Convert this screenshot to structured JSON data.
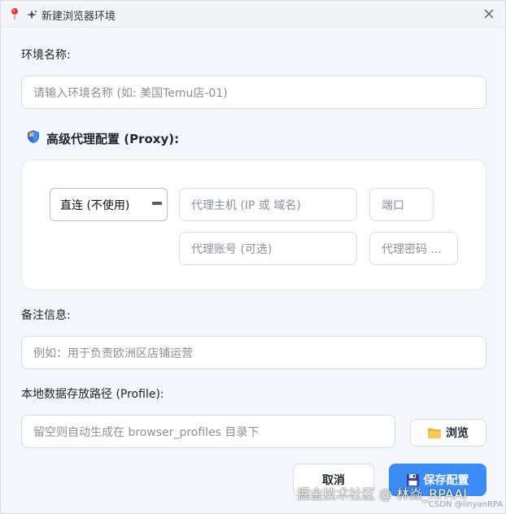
{
  "window": {
    "title": "新建浏览器环境"
  },
  "env_name": {
    "label": "环境名称:",
    "placeholder": "请输入环境名称 (如: 美国Temu店-01)"
  },
  "proxy": {
    "section_title": "高级代理配置 (Proxy):",
    "mode_selected": "直连 (不使用)",
    "host_placeholder": "代理主机 (IP 或 域名)",
    "port_placeholder": "端口",
    "user_placeholder": "代理账号 (可选)",
    "pass_placeholder": "代理密码 ..."
  },
  "notes": {
    "label": "备注信息:",
    "placeholder": "例如：用于负责欧洲区店铺运营"
  },
  "profile": {
    "label": "本地数据存放路径 (Profile):",
    "placeholder": "留空则自动生成在 browser_profiles 目录下",
    "browse_label": "浏览"
  },
  "actions": {
    "cancel_label": "取消",
    "save_label": "保存配置"
  },
  "watermark": {
    "main": "掘金技术社区 @ 林焱_RPAAI",
    "sub": "CSDN @linyanRPA"
  },
  "colors": {
    "accent": "#3b8cf5",
    "background": "#f4f6fb"
  },
  "icons": {
    "app": "pin-icon",
    "title": "sparkle-icon",
    "close": "close-icon",
    "proxy": "shield-icon",
    "browse": "folder-icon",
    "save": "floppy-disk-icon"
  }
}
